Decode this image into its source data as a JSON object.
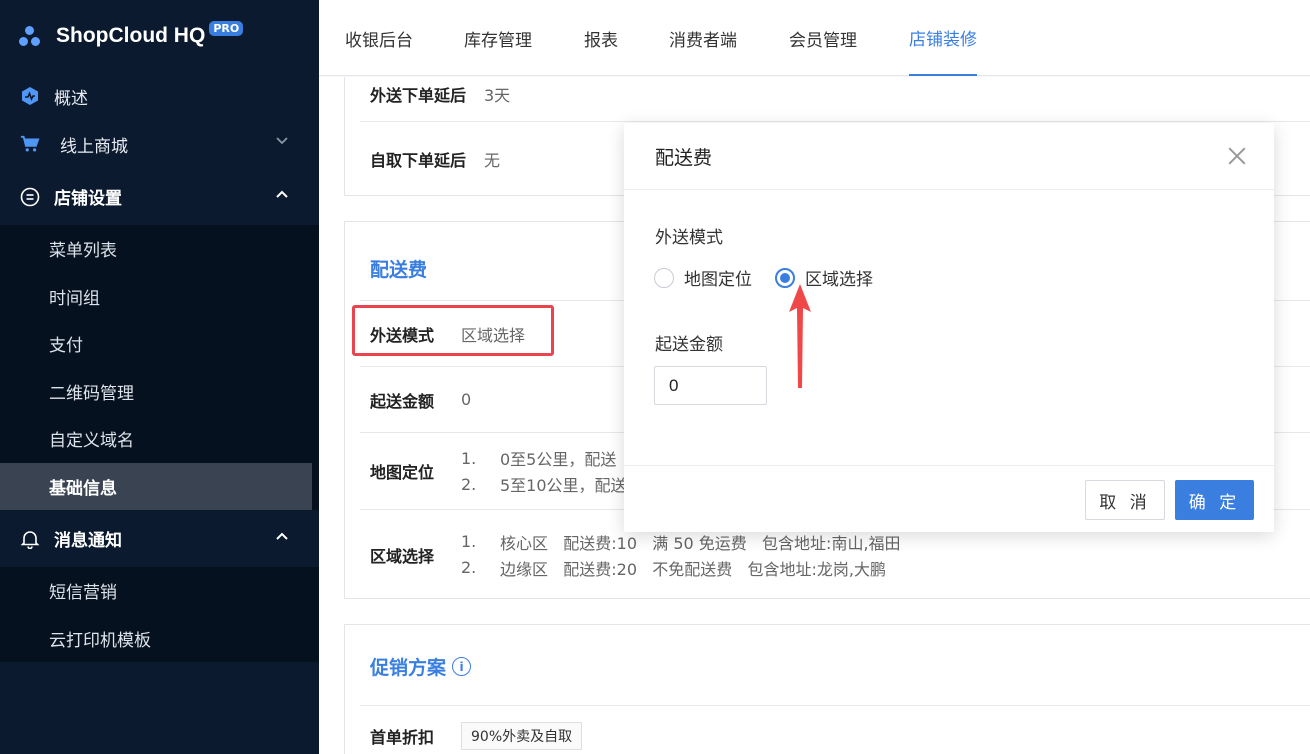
{
  "brand": {
    "name": "ShopCloud HQ",
    "badge": "PRO"
  },
  "sidebar": {
    "overview": "概述",
    "online_mall": "线上商城",
    "store_settings": "店铺设置",
    "store_items": [
      "菜单列表",
      "时间组",
      "支付",
      "二维码管理",
      "自定义域名",
      "基础信息"
    ],
    "active_item": "基础信息",
    "notifications": "消息通知",
    "notification_items": [
      "短信营销",
      "云打印机模板"
    ]
  },
  "topnav": {
    "tabs": [
      "收银后台",
      "库存管理",
      "报表",
      "消费者端",
      "会员管理",
      "店铺装修"
    ],
    "active": "店铺装修"
  },
  "content": {
    "delivery_delay_label": "外送下单延后",
    "delivery_delay_value": "3天",
    "pickup_delay_label": "自取下单延后",
    "pickup_delay_value": "无",
    "fee_section_title": "配送费",
    "mode_label": "外送模式",
    "mode_value": "区域选择",
    "min_amount_label": "起送金额",
    "min_amount_value": "0",
    "map_label": "地图定位",
    "map_items": [
      {
        "num": "1.",
        "text": "0至5公里，配送"
      },
      {
        "num": "2.",
        "text": "5至10公里，配送"
      }
    ],
    "zone_label": "区域选择",
    "zone_items": [
      {
        "num": "1.",
        "text": "核心区   配送费:10   满 50 免运费   包含地址:南山,福田"
      },
      {
        "num": "2.",
        "text": "边缘区   配送费:20   不免配送费   包含地址:龙岗,大鹏"
      }
    ],
    "promo_title": "促销方案",
    "first_discount_label": "首单折扣",
    "first_discount_value": "90%外卖及自取"
  },
  "modal": {
    "title": "配送费",
    "mode_label": "外送模式",
    "options": [
      "地图定位",
      "区域选择"
    ],
    "selected": "区域选择",
    "amount_label": "起送金额",
    "amount_value": "0",
    "cancel": "取消",
    "confirm": "确定"
  },
  "colors": {
    "accent": "#3a7fe0",
    "sidebar": "#0b1a2e",
    "highlight": "#e8454e"
  }
}
